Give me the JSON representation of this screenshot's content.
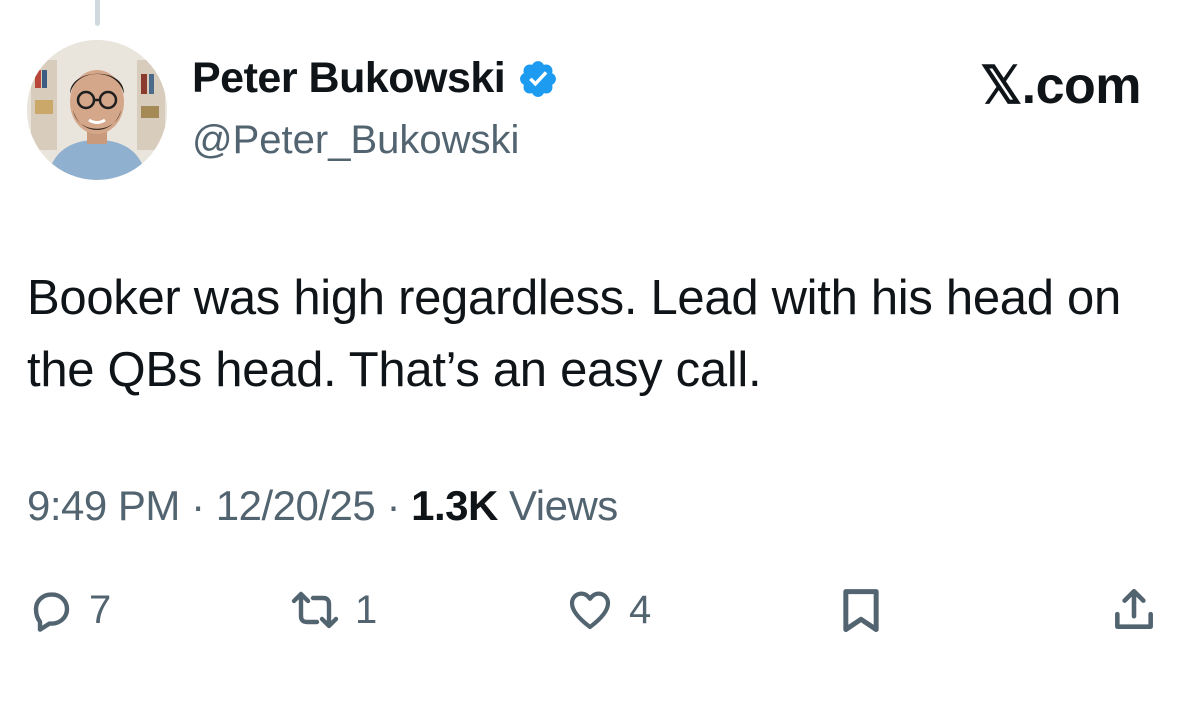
{
  "author": {
    "display_name": "Peter Bukowski",
    "handle": "@Peter_Bukowski",
    "verified": true,
    "verified_color": "#1d9bf0"
  },
  "brand": {
    "label": "𝕏.com"
  },
  "tweet": {
    "text": "Booker was high regardless. Lead with his head on the QBs head. That’s an easy call.",
    "time": "9:49 PM",
    "date": "12/20/25",
    "separator": "·",
    "views_count": "1.3K",
    "views_label": "Views"
  },
  "actions": {
    "reply_count": "7",
    "retweet_count": "1",
    "like_count": "4"
  },
  "icons": {
    "reply": "reply-icon",
    "retweet": "retweet-icon",
    "like": "heart-icon",
    "bookmark": "bookmark-icon",
    "share": "share-icon"
  },
  "colors": {
    "text_primary": "#0f1419",
    "text_secondary": "#536471"
  }
}
